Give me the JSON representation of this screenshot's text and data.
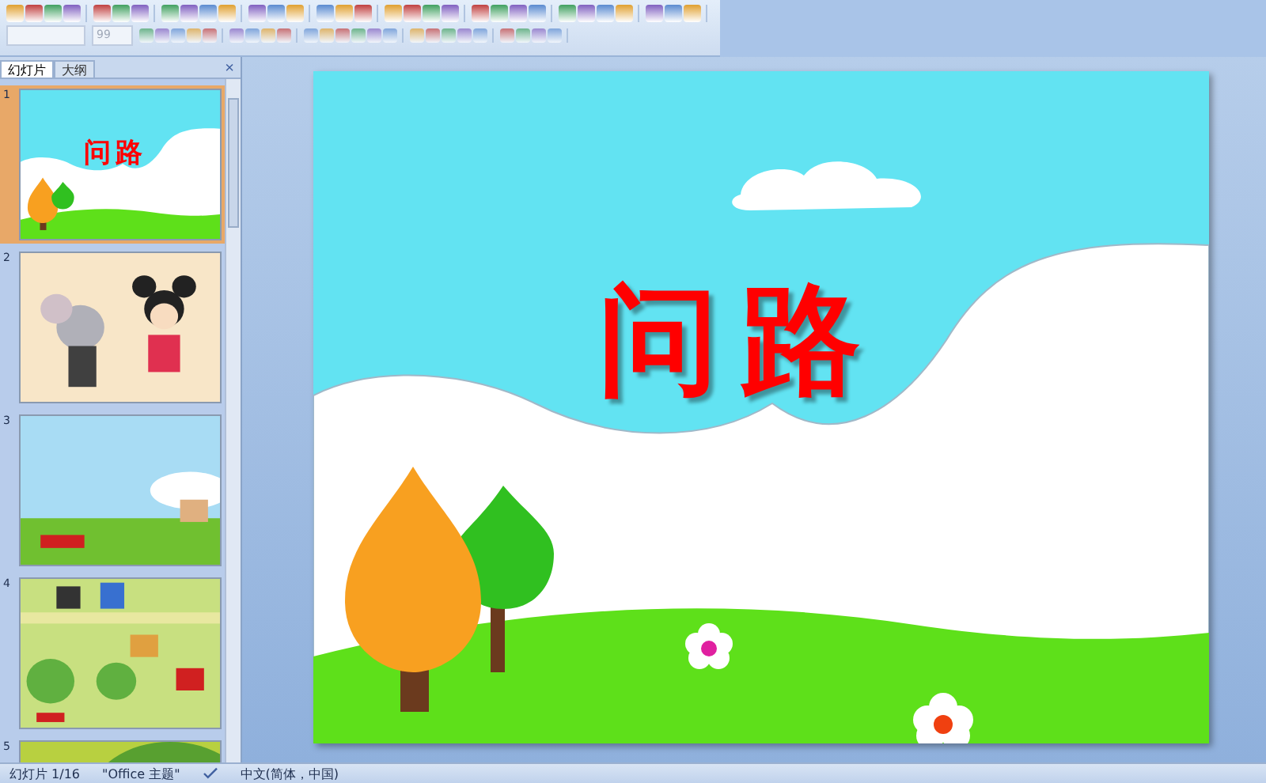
{
  "toolbar": {
    "font_size_field": {
      "value": "99",
      "disabled": true
    }
  },
  "panel": {
    "tabs": [
      {
        "label": "幻灯片",
        "selected": true
      },
      {
        "label": "大纲",
        "selected": false
      }
    ],
    "close": "×",
    "slides": [
      {
        "number": "1",
        "selected": true,
        "kind": "title",
        "title": "问路"
      },
      {
        "number": "2",
        "selected": false,
        "kind": "characters"
      },
      {
        "number": "3",
        "selected": false,
        "kind": "road"
      },
      {
        "number": "4",
        "selected": false,
        "kind": "town"
      },
      {
        "number": "5",
        "selected": false,
        "kind": "bush"
      }
    ]
  },
  "slide": {
    "title": "问路"
  },
  "status_bar": {
    "slide_position": "幻灯片 1/16",
    "theme": "\"Office 主题\"",
    "language": "中文(简体，中国)"
  }
}
